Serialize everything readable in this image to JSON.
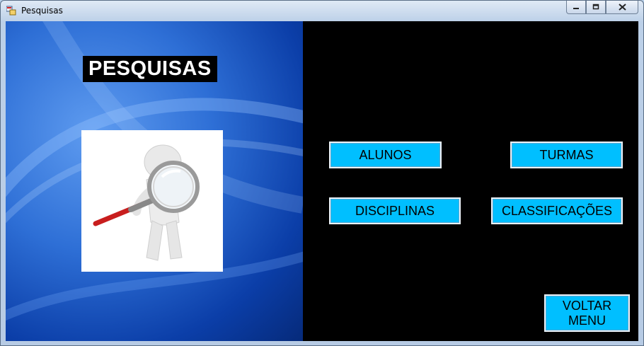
{
  "window": {
    "title": "Pesquisas",
    "controls": {
      "minimize_icon": "minimize-icon",
      "maximize_icon": "maximize-icon",
      "close_icon": "close-icon"
    }
  },
  "left_panel": {
    "heading": "PESQUISAS",
    "image": "magnifying-glass-figure"
  },
  "buttons": {
    "alunos": "ALUNOS",
    "turmas": "TURMAS",
    "disciplinas": "DISCIPLINAS",
    "classificacoes": "CLASSIFICAÇÕES",
    "voltar_line1": "VOLTAR",
    "voltar_line2": "MENU"
  },
  "colors": {
    "button_bg": "#00bfff",
    "right_panel_bg": "#000000",
    "heading_bg": "#000000"
  }
}
